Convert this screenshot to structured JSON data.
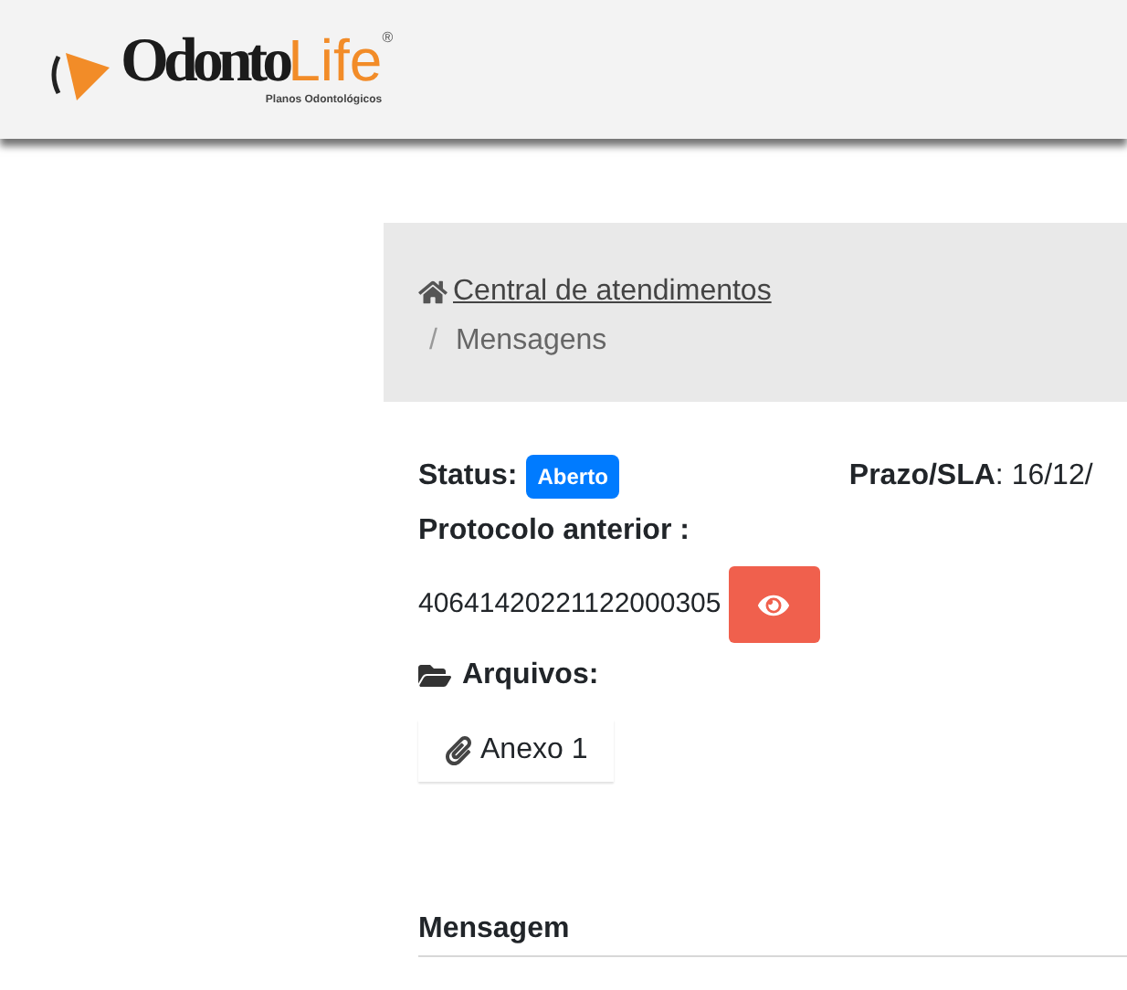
{
  "logo": {
    "name_dark": "Odonto",
    "name_accent": "Life",
    "mark": "®",
    "tagline": "Planos Odontológicos"
  },
  "breadcrumb": [
    {
      "label": "Central de atendimentos",
      "kind": "link"
    },
    {
      "label": "Mensagens",
      "kind": "current"
    }
  ],
  "breadcrumb_separator": "/",
  "status": {
    "label": "Status:",
    "badge": "Aberto"
  },
  "deadline": {
    "label": "Prazo/SLA",
    "value": ": 16/12/"
  },
  "previous_protocol": {
    "label": "Protocolo anterior :",
    "value": "40641420221122000305"
  },
  "files": {
    "label": "Arquivos:",
    "items": [
      "Anexo 1"
    ]
  },
  "message_heading": "Mensagem"
}
